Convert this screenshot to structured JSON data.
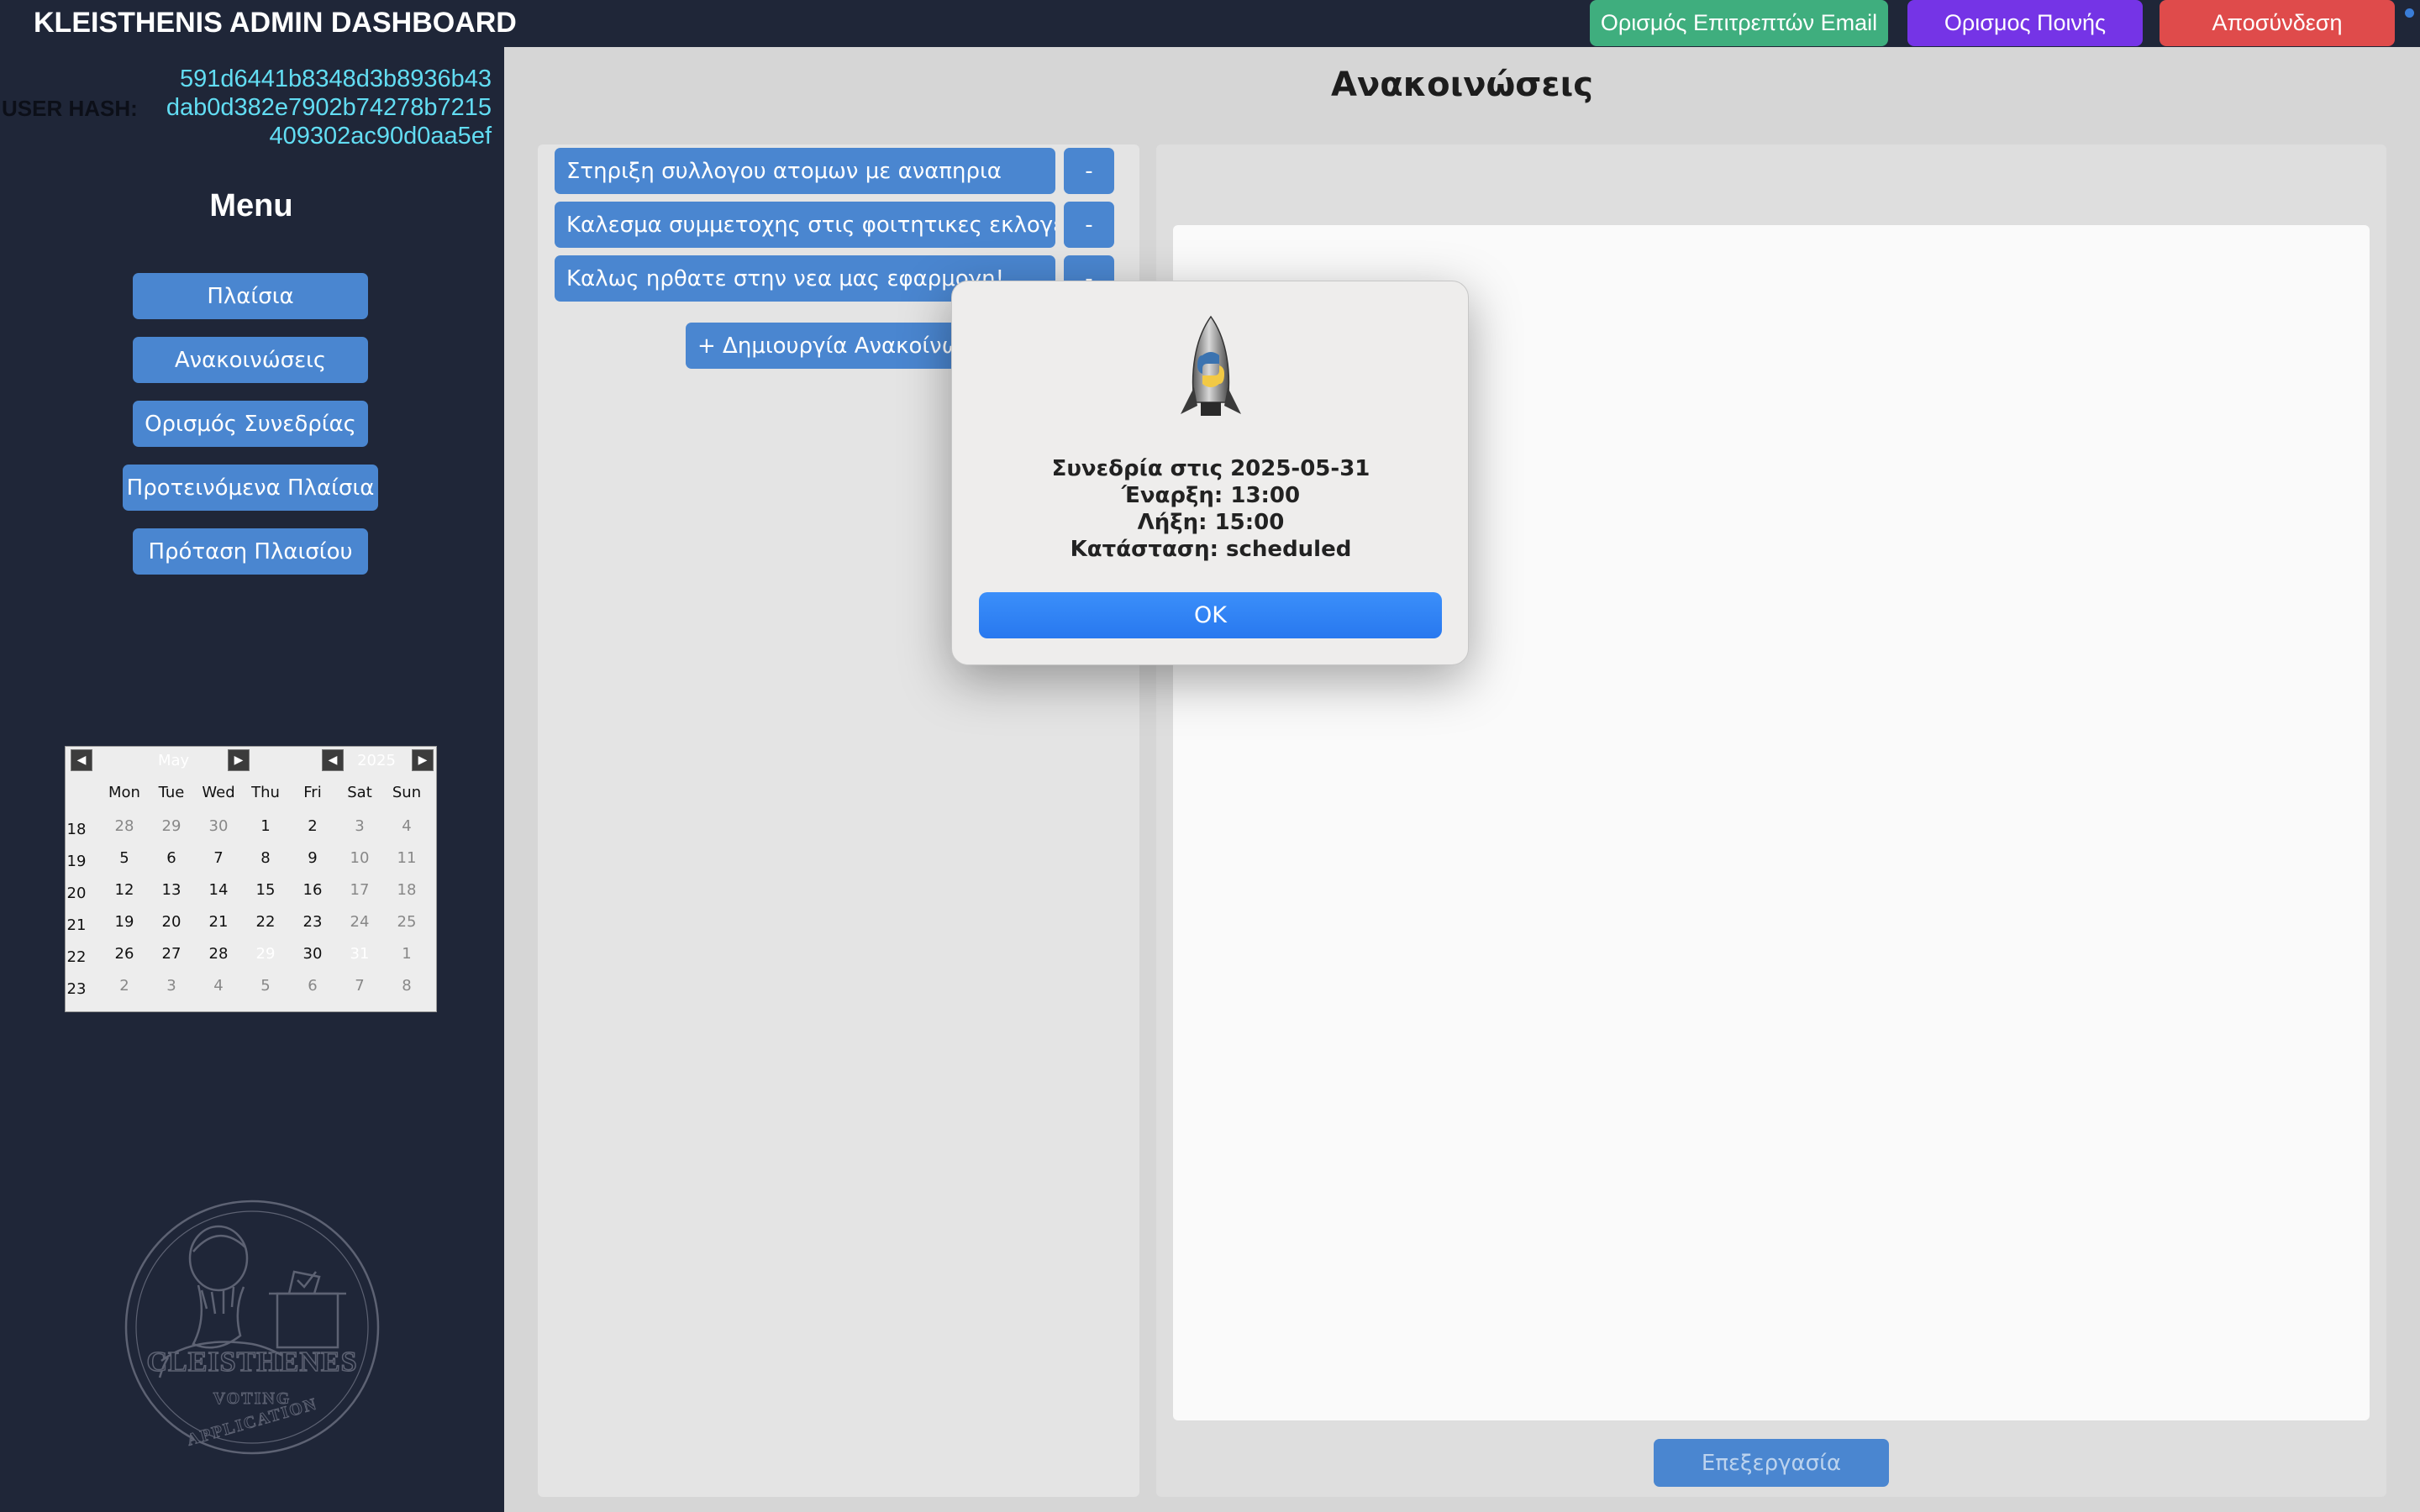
{
  "header": {
    "title": "KLEISTHENIS ADMIN DASHBOARD",
    "email_button": "Ορισμός Επιτρεπτών Email",
    "penalty_button": "Ορισμος Ποινής",
    "logout_button": "Αποσύνδεση"
  },
  "sidebar": {
    "hash_label": "USER HASH:",
    "hash_lines": [
      "591d6441b8348d3b8936b43",
      "dab0d382e7902b74278b7215",
      "409302ac90d0aa5ef"
    ],
    "menu_title": "Menu",
    "menu_items": [
      {
        "label": "Πλαίσια"
      },
      {
        "label": "Ανακοινώσεις"
      },
      {
        "label": "Ορισμός Συνεδρίας"
      },
      {
        "label": "Προτεινόμενα Πλαίσια"
      },
      {
        "label": "Πρόταση Πλαισίου"
      }
    ],
    "logo_text": {
      "line1": "CLEISTHENES",
      "line2": "VOTING",
      "line3": "APPLICATION"
    }
  },
  "calendar": {
    "month": "May",
    "year": "2025",
    "weekdays": [
      "Mon",
      "Tue",
      "Wed",
      "Thu",
      "Fri",
      "Sat",
      "Sun"
    ],
    "weeks": [
      {
        "week": "18",
        "days": [
          "28",
          "29",
          "30",
          "1",
          "2",
          "3",
          "4"
        ]
      },
      {
        "week": "19",
        "days": [
          "5",
          "6",
          "7",
          "8",
          "9",
          "10",
          "11"
        ]
      },
      {
        "week": "20",
        "days": [
          "12",
          "13",
          "14",
          "15",
          "16",
          "17",
          "18"
        ]
      },
      {
        "week": "21",
        "days": [
          "19",
          "20",
          "21",
          "22",
          "23",
          "24",
          "25"
        ]
      },
      {
        "week": "22",
        "days": [
          "26",
          "27",
          "28",
          "29",
          "30",
          "31",
          "1"
        ]
      },
      {
        "week": "23",
        "days": [
          "2",
          "3",
          "4",
          "5",
          "6",
          "7",
          "8"
        ]
      }
    ],
    "highlighted_days": [
      "29",
      "31"
    ]
  },
  "main": {
    "title": "Ανακοινώσεις",
    "announcements": [
      {
        "label": "Στηριξη συλλογου ατομων με αναπηρια",
        "delete": "-"
      },
      {
        "label": "Καλεσμα συμμετοχης στις φοιτητικες εκλογες",
        "delete": "-"
      },
      {
        "label": "Καλως ηρθατε στην νεα μας εφαρμογη!",
        "delete": "-"
      }
    ],
    "create_button": "+ Δημιουργία Ανακοίνωσης",
    "edit_button": "Επεξεργασία"
  },
  "dialog": {
    "line1": "Συνεδρία στις 2025-05-31",
    "line2": "Έναρξη: 13:00",
    "line3": "Λήξη: 15:00",
    "line4": "Κατάσταση: scheduled",
    "ok_button": "OK"
  },
  "colors": {
    "sidebar_bg": "#1f2638",
    "accent_blue": "#4a86d0",
    "email_green": "#3fae7e",
    "penalty_purple": "#7534e6",
    "logout_red": "#df4b4b",
    "hash_cyan": "#62ddf3"
  }
}
